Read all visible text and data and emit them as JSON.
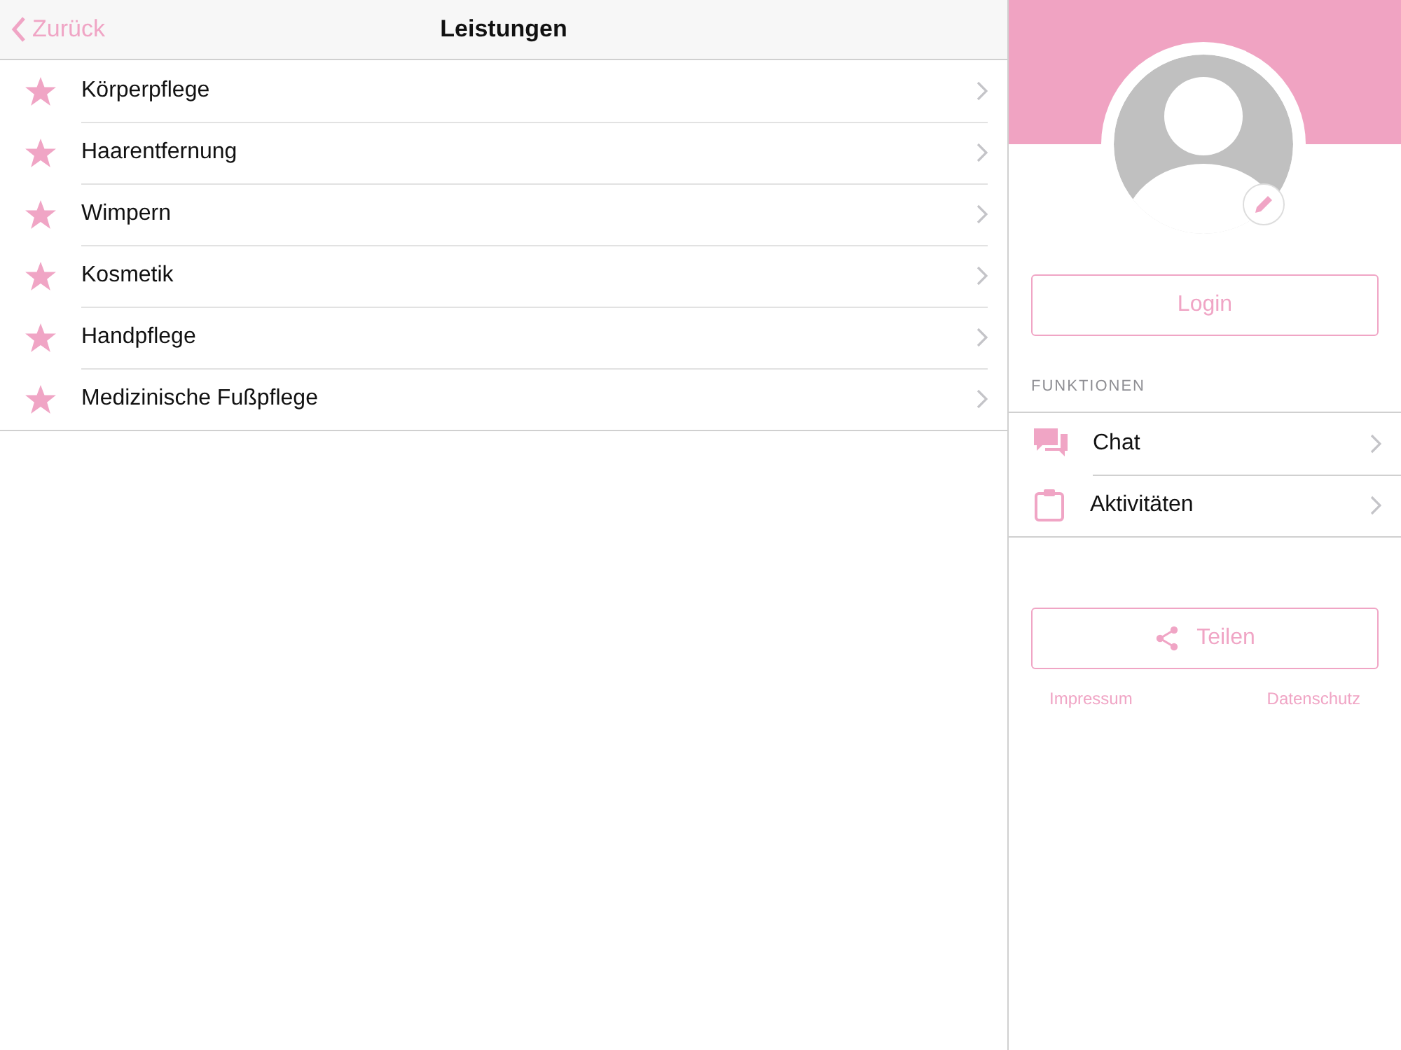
{
  "nav": {
    "back": "Zurück",
    "title": "Leistungen"
  },
  "services": [
    {
      "label": "Körperpflege"
    },
    {
      "label": "Haarentfernung"
    },
    {
      "label": "Wimpern"
    },
    {
      "label": "Kosmetik"
    },
    {
      "label": "Handpflege"
    },
    {
      "label": "Medizinische Fußpflege"
    }
  ],
  "profile": {
    "login": "Login",
    "section": "FUNKTIONEN",
    "functions": [
      {
        "kind": "chat",
        "label": "Chat"
      },
      {
        "kind": "clipboard",
        "label": "Aktivitäten"
      }
    ],
    "share": "Teilen",
    "links": [
      "Impressum",
      "Datenschutz"
    ]
  }
}
